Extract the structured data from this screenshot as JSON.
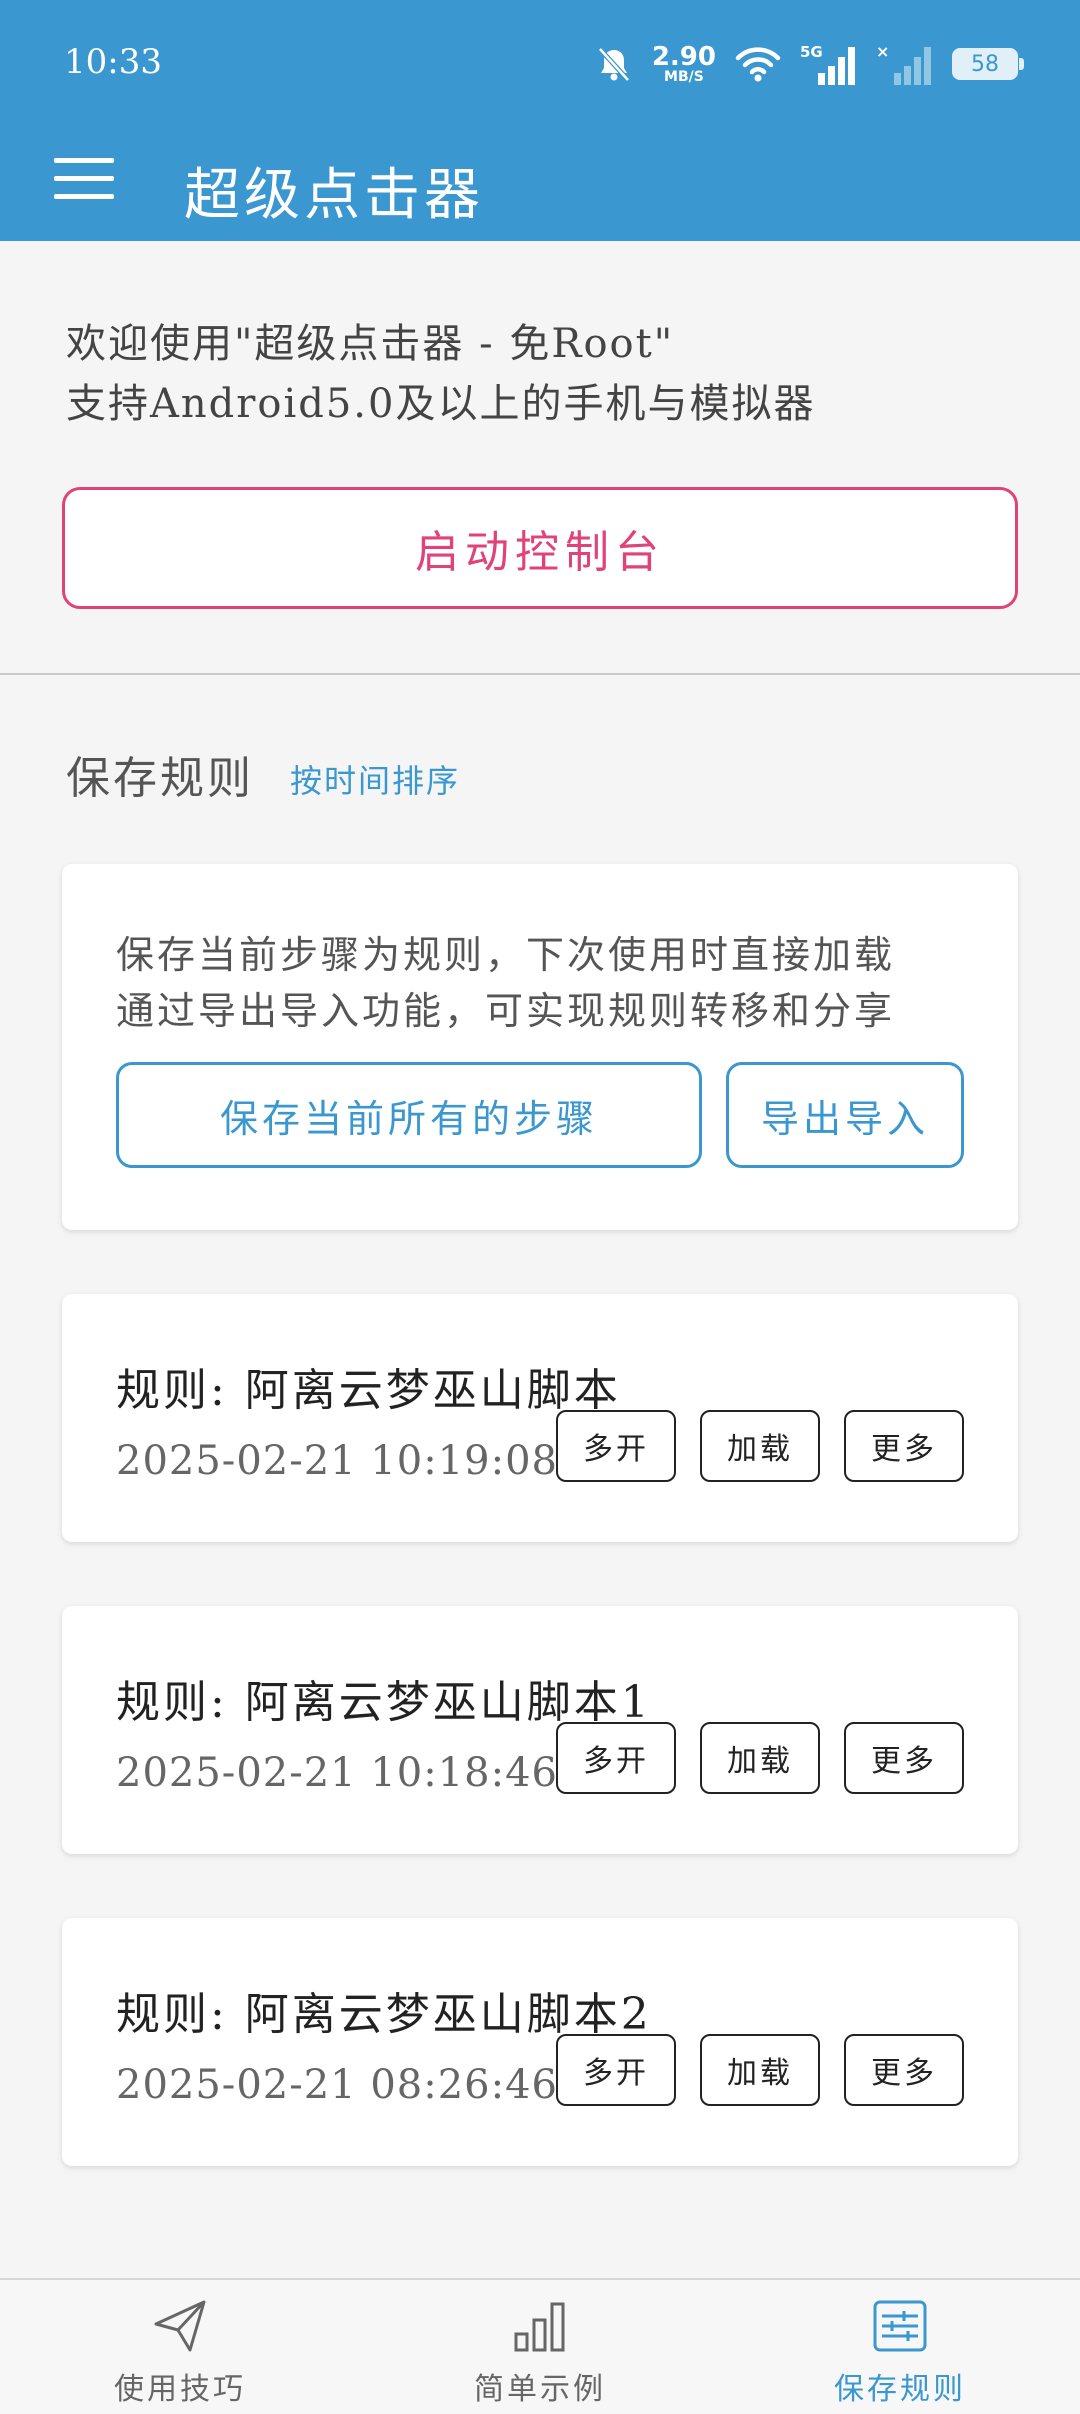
{
  "status_bar": {
    "time": "10:33",
    "net_speed_value": "2.90",
    "net_speed_unit": "MB/S",
    "network_type": "5G",
    "battery": "58"
  },
  "toolbar": {
    "title": "超级点击器"
  },
  "intro": {
    "line1": "欢迎使用\"超级点击器 - 免Root\"",
    "line2": "支持Android5.0及以上的手机与模拟器",
    "launch_label": "启动控制台"
  },
  "saved": {
    "section_title": "保存规则",
    "sort_label": "按时间排序",
    "info_line1": "保存当前步骤为规则，下次使用时直接加载",
    "info_line2": "通过导出导入功能，可实现规则转移和分享",
    "save_all_label": "保存当前所有的步骤",
    "export_import_label": "导出导入"
  },
  "rules": [
    {
      "title": "规则: 阿离云梦巫山脚本",
      "date": "2025-02-21 10:19:08",
      "multi": "多开",
      "load": "加载",
      "more": "更多"
    },
    {
      "title": "规则: 阿离云梦巫山脚本1",
      "date": "2025-02-21 10:18:46",
      "multi": "多开",
      "load": "加载",
      "more": "更多"
    },
    {
      "title": "规则: 阿离云梦巫山脚本2",
      "date": "2025-02-21 08:26:46",
      "multi": "多开",
      "load": "加载",
      "more": "更多"
    }
  ],
  "bottom_nav": {
    "tips": "使用技巧",
    "examples": "简单示例",
    "saved_rules": "保存规则",
    "active": "saved_rules"
  },
  "colors": {
    "primary": "#3a97d0",
    "accent": "#e0427a"
  }
}
